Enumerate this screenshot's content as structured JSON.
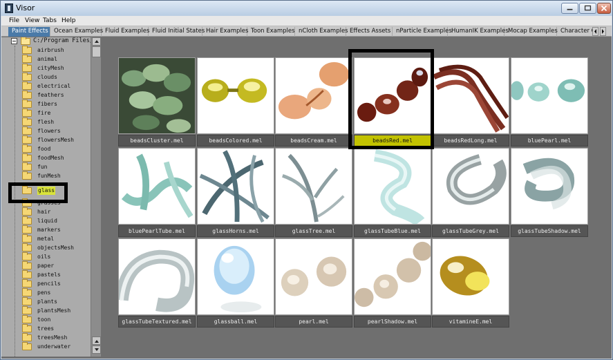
{
  "window": {
    "title": "Visor"
  },
  "menu": [
    "File",
    "View",
    "Tabs",
    "Help"
  ],
  "tabs": [
    "Paint Effects",
    "Ocean Examples",
    "Fluid Examples",
    "Fluid Initial States",
    "Hair Examples",
    "Toon Examples",
    "nCloth Examples",
    "Effects Assets",
    "nParticle Examples",
    "HumanIK Examples",
    "Mocap Examples",
    "Character Cli"
  ],
  "active_tab": "Paint Effects",
  "tree": {
    "root": "C:/Program Files/A",
    "items": [
      "airbrush",
      "animal",
      "cityMesh",
      "clouds",
      "electrical",
      "feathers",
      "fibers",
      "fire",
      "flesh",
      "flowers",
      "flowersMesh",
      "food",
      "foodMesh",
      "fun",
      "funMesh",
      "glass",
      "grasses",
      "hair",
      "liquid",
      "markers",
      "metal",
      "objectsMesh",
      "oils",
      "paper",
      "pastels",
      "pencils",
      "pens",
      "plants",
      "plantsMesh",
      "toon",
      "trees",
      "treesMesh",
      "underwater"
    ],
    "selected": "glass"
  },
  "grid": [
    {
      "label": "beadsCluster.mel",
      "icon": "beads-cluster-thumbnail"
    },
    {
      "label": "beadsColored.mel",
      "icon": "beads-colored-thumbnail"
    },
    {
      "label": "beadsCream.mel",
      "icon": "beads-cream-thumbnail"
    },
    {
      "label": "beadsRed.mel",
      "icon": "beads-red-thumbnail"
    },
    {
      "label": "beadsRedLong.mel",
      "icon": "beads-red-long-thumbnail"
    },
    {
      "label": "bluePearl.mel",
      "icon": "blue-pearl-thumbnail"
    },
    {
      "label": "bluePearlTube.mel",
      "icon": "blue-pearl-tube-thumbnail"
    },
    {
      "label": "glassHorns.mel",
      "icon": "glass-horns-thumbnail"
    },
    {
      "label": "glassTree.mel",
      "icon": "glass-tree-thumbnail"
    },
    {
      "label": "glassTubeBlue.mel",
      "icon": "glass-tube-blue-thumbnail"
    },
    {
      "label": "glassTubeGrey.mel",
      "icon": "glass-tube-grey-thumbnail"
    },
    {
      "label": "glassTubeShadow.mel",
      "icon": "glass-tube-shadow-thumbnail"
    },
    {
      "label": "glassTubeTextured.mel",
      "icon": "glass-tube-textured-thumbnail"
    },
    {
      "label": "glassball.mel",
      "icon": "glass-ball-thumbnail"
    },
    {
      "label": "pearl.mel",
      "icon": "pearl-thumbnail"
    },
    {
      "label": "pearlShadow.mel",
      "icon": "pearl-shadow-thumbnail"
    },
    {
      "label": "vitamineE.mel",
      "icon": "vitamine-e-thumbnail"
    }
  ],
  "selected_item": "beadsRed.mel",
  "colors": {
    "selection": "#c2c200",
    "tree_highlight": "#d9e33a",
    "active_tab": "#4a7aa8"
  }
}
